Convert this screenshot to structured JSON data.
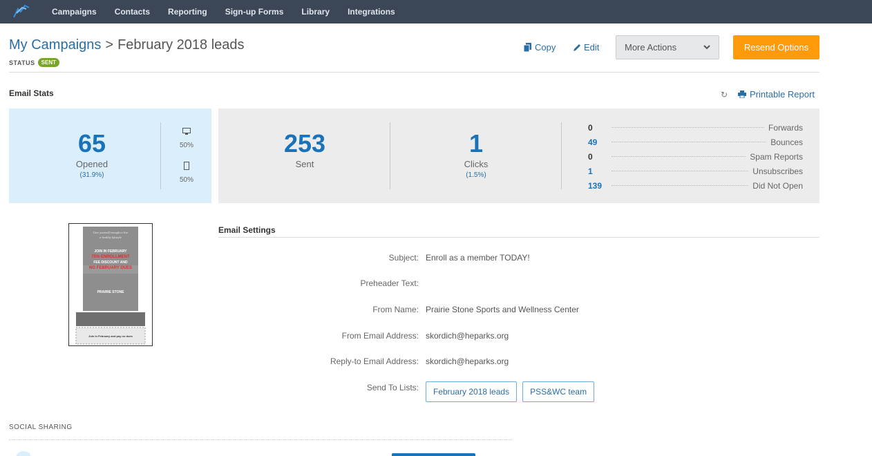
{
  "nav": {
    "items": [
      {
        "label": "Campaigns"
      },
      {
        "label": "Contacts"
      },
      {
        "label": "Reporting"
      },
      {
        "label": "Sign-up Forms"
      },
      {
        "label": "Library"
      },
      {
        "label": "Integrations"
      }
    ]
  },
  "header": {
    "breadcrumb_root": "My Campaigns",
    "separator": ">",
    "title": "February 2018 leads",
    "status_label": "STATUS",
    "status_badge": "SENT",
    "copy_label": "Copy",
    "edit_label": "Edit",
    "more_actions_label": "More Actions",
    "resend_label": "Resend Options"
  },
  "stats": {
    "section_title": "Email Stats",
    "printable_label": "Printable Report",
    "opened": {
      "value": "65",
      "label": "Opened",
      "pct": "(31.9%)"
    },
    "desktop_pct": "50%",
    "mobile_pct": "50%",
    "sent": {
      "value": "253",
      "label": "Sent"
    },
    "clicks": {
      "value": "1",
      "label": "Clicks",
      "pct": "(1.5%)"
    },
    "mini": [
      {
        "value": "0",
        "label": "Forwards"
      },
      {
        "value": "49",
        "label": "Bounces"
      },
      {
        "value": "0",
        "label": "Spam Reports"
      },
      {
        "value": "1",
        "label": "Unsubscribes"
      },
      {
        "value": "139",
        "label": "Did Not Open"
      }
    ]
  },
  "settings": {
    "title": "Email Settings",
    "rows": [
      {
        "label": "Subject:",
        "value": "Enroll as a member TODAY!"
      },
      {
        "label": "Preheader Text:",
        "value": ""
      },
      {
        "label": "From Name:",
        "value": "Prairie Stone Sports and Wellness Center"
      },
      {
        "label": "From Email Address:",
        "value": "skordich@heparks.org"
      },
      {
        "label": "Reply-to Email Address:",
        "value": "skordich@heparks.org"
      }
    ],
    "lists_label": "Send To Lists:",
    "lists": [
      "February 2018 leads",
      "PSS&WC team"
    ]
  },
  "preview": {
    "lines": [
      "Give yourself enough to live",
      "a healthy lifestyle",
      "JOIN IN FEBRUARY",
      "75% ENROLLMENT",
      "FEE DISCOUNT AND",
      "NO FEBRUARY DUES",
      "PRAIRIE STONE",
      "Join in February and pay no dues"
    ]
  },
  "social": {
    "title": "SOCIAL SHARING"
  },
  "colors": {
    "nav_bg": "#3b4656",
    "link": "#2a6ea6",
    "accent_orange": "#ff9a0a",
    "status_green": "#7aa52b",
    "opened_bg": "#dbeefb",
    "stats_bg": "#ececec"
  }
}
